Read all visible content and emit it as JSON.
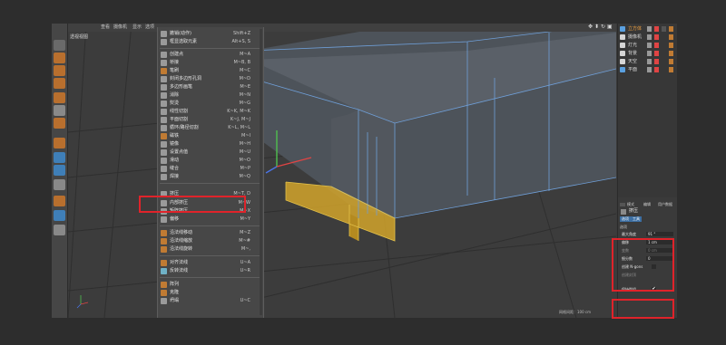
{
  "viewport": {
    "menubar": [
      "查看",
      "摄像机",
      "显示",
      "选项"
    ],
    "title": "透视视图",
    "status": "网格间距：100 cm"
  },
  "context_menu": {
    "items": [
      {
        "label": "撤销(动作)",
        "shortcut": "Shift+Z"
      },
      {
        "label": "框显选取元素",
        "shortcut": "Alt+S, S"
      },
      {
        "label": "创建点",
        "shortcut": "M~A"
      },
      {
        "label": "桥接",
        "shortcut": "M~B, B"
      },
      {
        "label": "笔刷",
        "shortcut": "M~C"
      },
      {
        "label": "封闭多边形孔洞",
        "shortcut": "M~D"
      },
      {
        "label": "多边形画笔",
        "shortcut": "M~E"
      },
      {
        "label": "消除",
        "shortcut": "M~N"
      },
      {
        "label": "熨烫",
        "shortcut": "M~G"
      },
      {
        "label": "线性切割",
        "shortcut": "K~K, M~K"
      },
      {
        "label": "平面切割",
        "shortcut": "K~J, M~J"
      },
      {
        "label": "循环/路径切割",
        "shortcut": "K~L, M~L"
      },
      {
        "label": "磁铁",
        "shortcut": "M~I"
      },
      {
        "label": "镜像",
        "shortcut": "M~H"
      },
      {
        "label": "设置点值",
        "shortcut": "M~U"
      },
      {
        "label": "滑动",
        "shortcut": "M~O"
      },
      {
        "label": "缝合",
        "shortcut": "M~P"
      },
      {
        "label": "焊接",
        "shortcut": "M~Q"
      },
      {
        "label": "挤压",
        "shortcut": "M~T, D"
      },
      {
        "label": "内部挤压",
        "shortcut": "M~W"
      },
      {
        "label": "矩阵挤压",
        "shortcut": "M~X"
      },
      {
        "label": "偏移",
        "shortcut": "M~Y"
      },
      {
        "label": "沿法线移动",
        "shortcut": "M~Z"
      },
      {
        "label": "沿法线缩放",
        "shortcut": "M~#"
      },
      {
        "label": "沿法线旋转",
        "shortcut": "M~,"
      },
      {
        "label": "对齐法线",
        "shortcut": "U~A"
      },
      {
        "label": "反转法线",
        "shortcut": "U~R"
      },
      {
        "label": "阵列",
        "shortcut": ""
      },
      {
        "label": "克隆",
        "shortcut": ""
      },
      {
        "label": "坍塌",
        "shortcut": "U~C"
      }
    ]
  },
  "objects": [
    {
      "name": "立方体"
    },
    {
      "name": "摄像机"
    },
    {
      "name": "灯光"
    },
    {
      "name": "背景"
    },
    {
      "name": "天空"
    },
    {
      "name": "平面"
    }
  ],
  "attributes": {
    "menu": [
      "模式",
      "编辑",
      "用户数据"
    ],
    "tool_title": "挤压",
    "tabs": [
      "选项",
      "工具"
    ],
    "section": "选项",
    "fields": [
      {
        "label": "最大角度",
        "value": "91 °"
      },
      {
        "label": "偏移",
        "value": "1 cm"
      },
      {
        "label": "变数",
        "value": "0 cm"
      },
      {
        "label": "细分数",
        "value": "0"
      }
    ],
    "ngons_label": "创建 N-gons",
    "cap_label": "创建封顶",
    "keep_groups_label": "保持群组",
    "keep_groups_check": "✔"
  },
  "colors": {
    "highlight": "#e0232a",
    "selected_polys": "#d9a82a",
    "wire": "#6f9fd8"
  }
}
